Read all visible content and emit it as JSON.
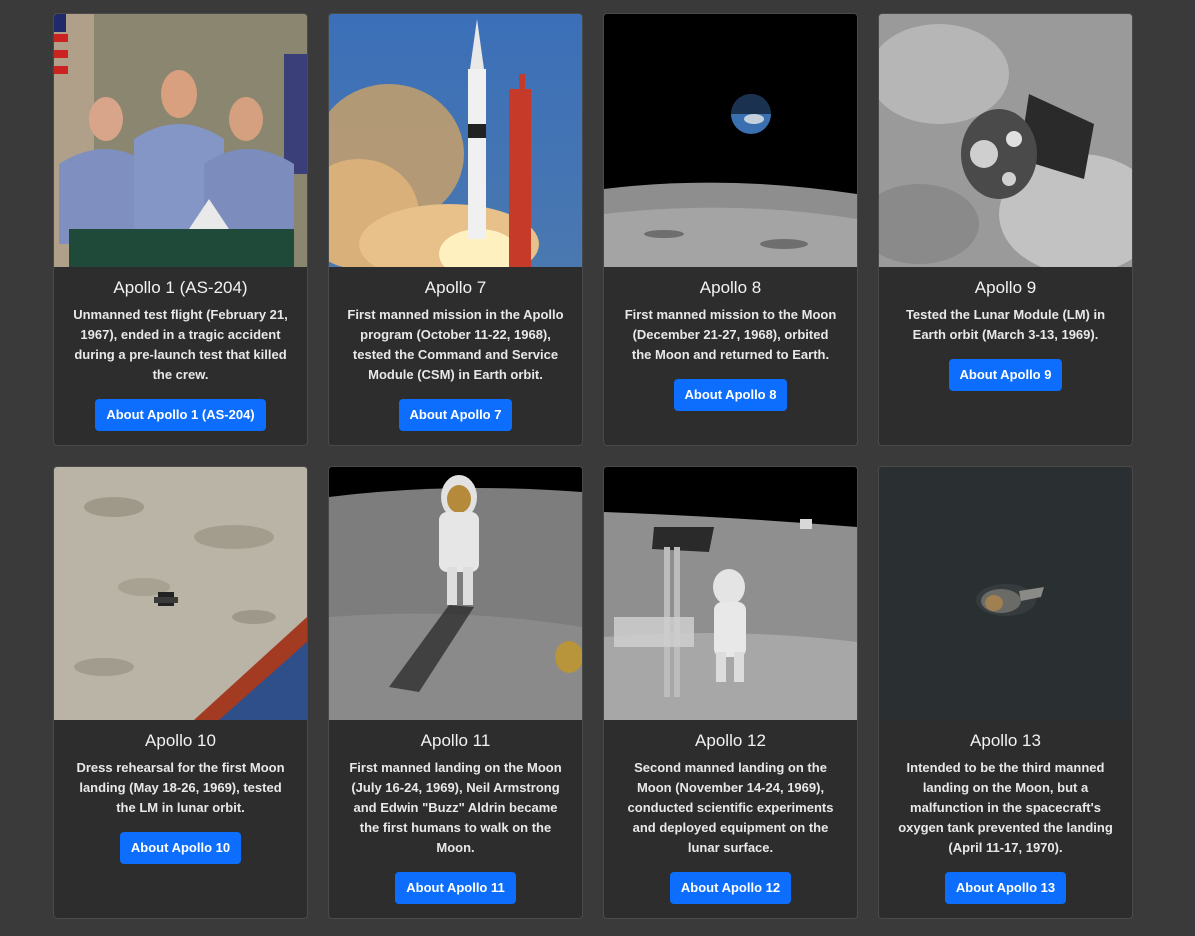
{
  "missions": [
    {
      "title": "Apollo 1 (AS-204)",
      "description": "Unmanned test flight (February 21, 1967), ended in a tragic accident during a pre-launch test that killed the crew.",
      "button": "About Apollo 1 (AS-204)"
    },
    {
      "title": "Apollo 7",
      "description": "First manned mission in the Apollo program (October 11-22, 1968), tested the Command and Service Module (CSM) in Earth orbit.",
      "button": "About Apollo 7"
    },
    {
      "title": "Apollo 8",
      "description": "First manned mission to the Moon (December 21-27, 1968), orbited the Moon and returned to Earth.",
      "button": "About Apollo 8"
    },
    {
      "title": "Apollo 9",
      "description": "Tested the Lunar Module (LM) in Earth orbit (March 3-13, 1969).",
      "button": "About Apollo 9"
    },
    {
      "title": "Apollo 10",
      "description": "Dress rehearsal for the first Moon landing (May 18-26, 1969), tested the LM in lunar orbit.",
      "button": "About Apollo 10"
    },
    {
      "title": "Apollo 11",
      "description": "First manned landing on the Moon (July 16-24, 1969), Neil Armstrong and Edwin \"Buzz\" Aldrin became the first humans to walk on the Moon.",
      "button": "About Apollo 11"
    },
    {
      "title": "Apollo 12",
      "description": "Second manned landing on the Moon (November 14-24, 1969), conducted scientific experiments and deployed equipment on the lunar surface.",
      "button": "About Apollo 12"
    },
    {
      "title": "Apollo 13",
      "description": "Intended to be the third manned landing on the Moon, but a malfunction in the spacecraft's oxygen tank prevented the landing (April 11-17, 1970).",
      "button": "About Apollo 13"
    }
  ],
  "colors": {
    "page_background": "#3a3a3a",
    "card_background": "#2d2d2d",
    "button_blue": "#0d6efd"
  }
}
